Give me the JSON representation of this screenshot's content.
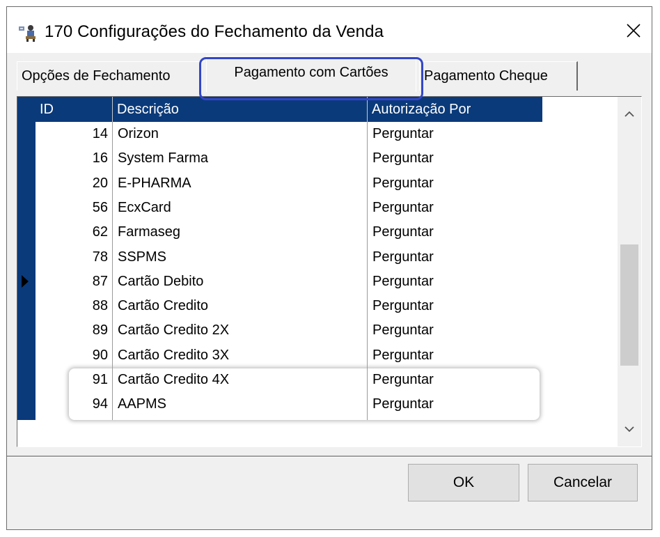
{
  "window": {
    "title": "170 Configurações do Fechamento da Venda"
  },
  "tabs": [
    {
      "label": "Opções de Fechamento"
    },
    {
      "label": "Pagamento com Cartões",
      "selected": true
    },
    {
      "label": "Pagamento Cheque"
    }
  ],
  "grid": {
    "columns": [
      "ID",
      "Descrição",
      "Autorização Por"
    ],
    "rows": [
      {
        "id": "14",
        "desc": "Orizon",
        "auth": "Perguntar"
      },
      {
        "id": "16",
        "desc": "System Farma",
        "auth": "Perguntar"
      },
      {
        "id": "20",
        "desc": "E-PHARMA",
        "auth": "Perguntar"
      },
      {
        "id": "56",
        "desc": "EcxCard",
        "auth": "Perguntar"
      },
      {
        "id": "62",
        "desc": "Farmaseg",
        "auth": "Perguntar"
      },
      {
        "id": "78",
        "desc": "SSPMS",
        "auth": "Perguntar"
      },
      {
        "id": "87",
        "desc": "Cartão Debito",
        "auth": "Perguntar"
      },
      {
        "id": "88",
        "desc": "Cartão Credito",
        "auth": "Perguntar"
      },
      {
        "id": "89",
        "desc": "Cartão Credito 2X",
        "auth": "Perguntar"
      },
      {
        "id": "90",
        "desc": "Cartão Credito 3X",
        "auth": "Perguntar"
      },
      {
        "id": "91",
        "desc": "Cartão Credito 4X",
        "auth": "Perguntar"
      },
      {
        "id": "94",
        "desc": "AAPMS",
        "auth": "Perguntar"
      }
    ],
    "current_row_id": "87"
  },
  "buttons": {
    "ok": "OK",
    "cancel": "Cancelar"
  },
  "icons": {
    "app": "app-icon",
    "close": "close-icon",
    "scroll_up": "chevron-up-icon",
    "scroll_down": "chevron-down-icon",
    "current_row": "row-pointer-icon"
  },
  "colors": {
    "header_bg": "#0a3a7a",
    "tab_highlight": "#3346c8"
  }
}
